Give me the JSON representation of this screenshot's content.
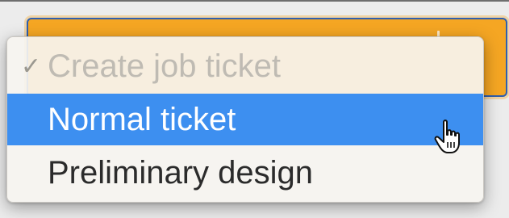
{
  "dropdown": {
    "items": [
      {
        "label": "Create job ticket",
        "checkmark": "✓",
        "state": "checked-disabled"
      },
      {
        "label": "Normal ticket",
        "state": "highlighted"
      },
      {
        "label": "Preliminary design",
        "state": "normal"
      }
    ]
  },
  "colors": {
    "button_fill": "#f5a623",
    "focus_ring": "#2f5fae",
    "highlight": "#3d8ff0",
    "menu_background": "#f6f4f0"
  },
  "cursor": {
    "icon": "pointing-hand-cursor-icon"
  }
}
